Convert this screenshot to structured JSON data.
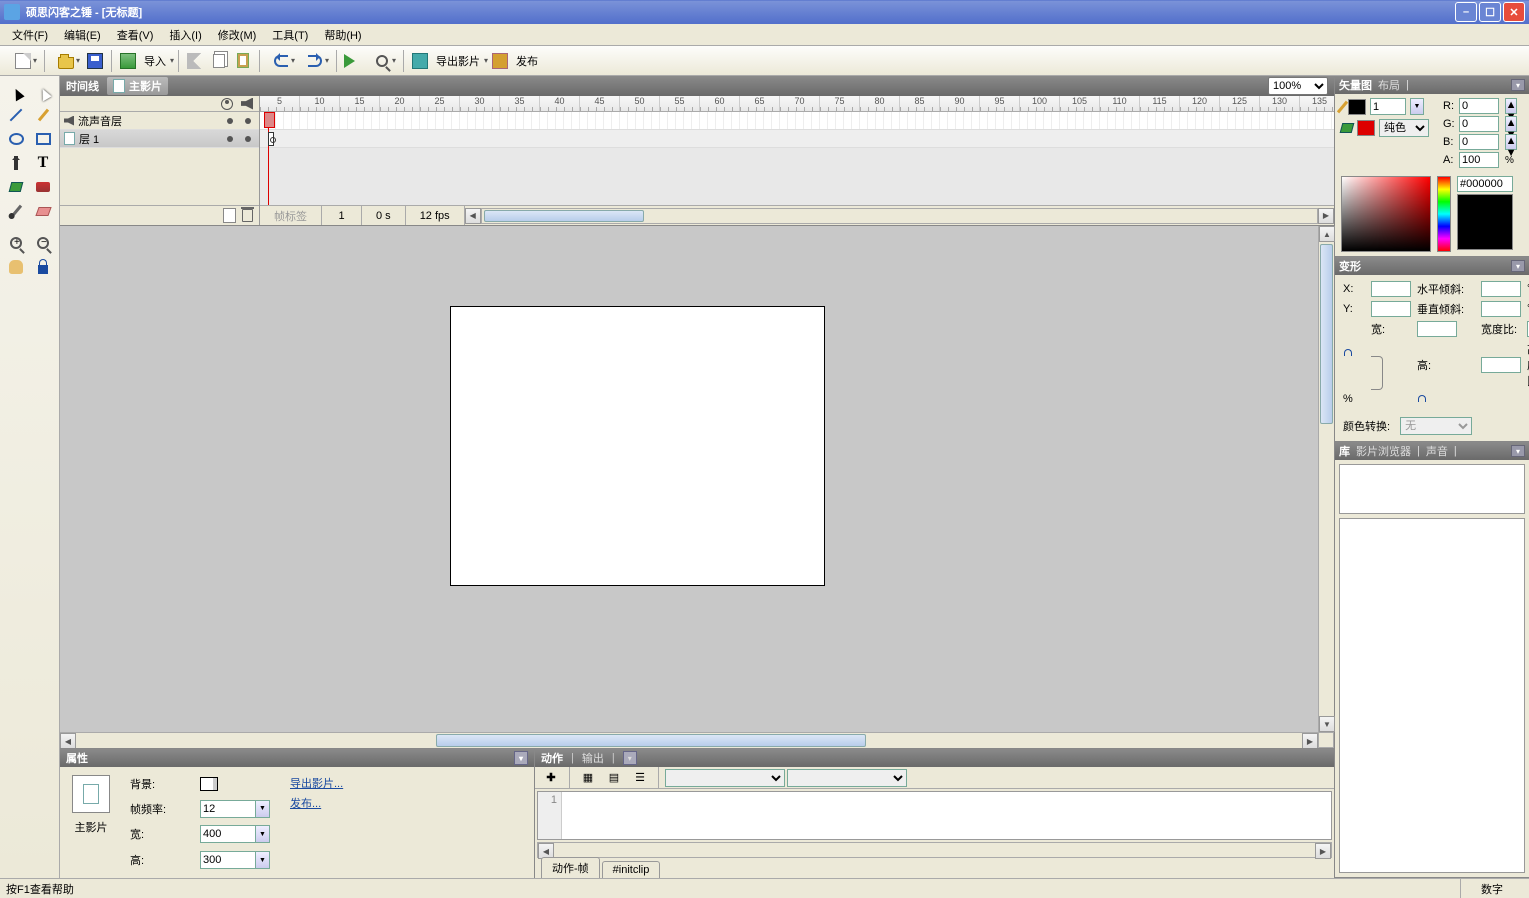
{
  "title": "硕思闪客之锤  -  [无标题]",
  "menu": [
    "文件(F)",
    "编辑(E)",
    "查看(V)",
    "插入(I)",
    "修改(M)",
    "工具(T)",
    "帮助(H)"
  ],
  "toolbar": {
    "import": "导入",
    "export_movie": "导出影片",
    "publish": "发布"
  },
  "timeline": {
    "title": "时间线",
    "scene": "主影片",
    "zoom": "100%",
    "ticks": [
      "5",
      "10",
      "15",
      "20",
      "25",
      "30",
      "35",
      "40",
      "45",
      "50",
      "55",
      "60",
      "65",
      "70",
      "75",
      "80",
      "85",
      "90",
      "95",
      "100",
      "105",
      "110",
      "115",
      "120",
      "125",
      "130",
      "135"
    ],
    "layers": [
      {
        "name": "流声音层"
      },
      {
        "name": "层 1"
      }
    ],
    "footer": {
      "frame_label": "帧标签",
      "frame": "1",
      "time": "0 s",
      "fps": "12 fps"
    }
  },
  "properties": {
    "title": "属性",
    "type": "主影片",
    "labels": {
      "bg": "背景:",
      "rate": "帧频率:",
      "w": "宽:",
      "h": "高:"
    },
    "values": {
      "rate": "12",
      "w": "400",
      "h": "300"
    },
    "links": {
      "export": "导出影片...",
      "publish": "发布..."
    }
  },
  "actions": {
    "title": "动作",
    "output": "输出",
    "gutter": "1",
    "tabs": [
      "动作-帧",
      "#initclip"
    ]
  },
  "vector": {
    "title": "矢量图",
    "layout": "布局",
    "stroke_w": "1",
    "fill_type": "纯色",
    "rgba": {
      "r": "0",
      "g": "0",
      "b": "0",
      "a": "100"
    },
    "pct": "%",
    "hex": "#000000"
  },
  "transform": {
    "title": "变形",
    "labels": {
      "x": "X:",
      "y": "Y:",
      "w": "宽:",
      "h": "高:",
      "skewh": "水平倾斜:",
      "skewv": "垂直倾斜:",
      "sw": "宽度比:",
      "sh": "高度比:",
      "deg": "°",
      "pct": "%",
      "cc": "颜色转换:"
    },
    "color_convert": "无"
  },
  "library": {
    "title": "库",
    "browser": "影片浏览器",
    "sound": "声音"
  },
  "status": {
    "help": "按F1查看帮助",
    "num": "数字"
  },
  "rgba_labels": {
    "r": "R:",
    "g": "G:",
    "b": "B:",
    "a": "A:"
  }
}
